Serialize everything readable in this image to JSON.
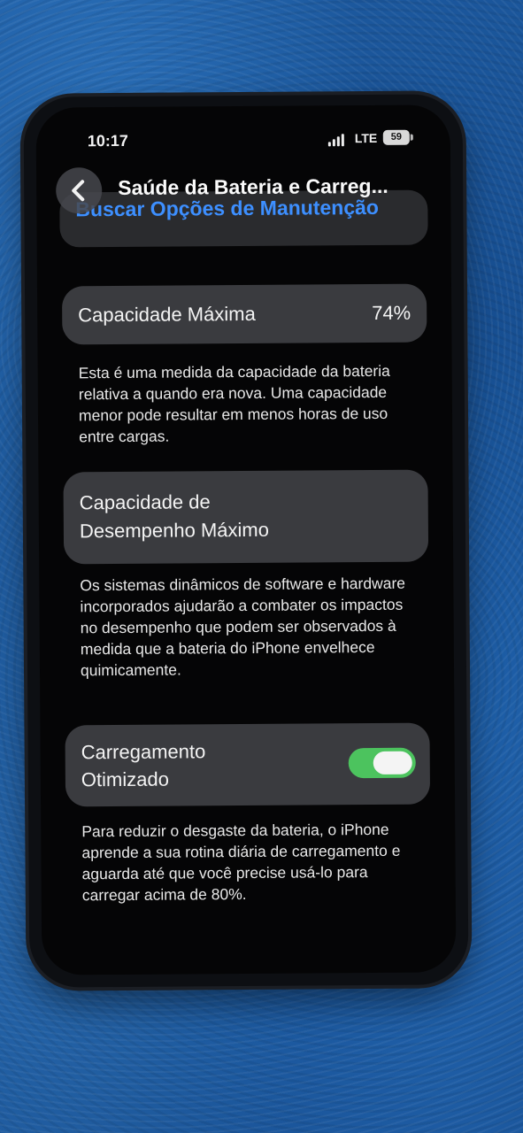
{
  "status_bar": {
    "time": "10:17",
    "network": "LTE",
    "battery_percent": "59"
  },
  "nav": {
    "title": "Saúde da Bateria e Carreg..."
  },
  "top_card": {
    "link_label": "Buscar Opções de Manutenção"
  },
  "max_capacity": {
    "label": "Capacidade Máxima",
    "value": "74%",
    "description": "Esta é uma medida da capacidade da bateria relativa a quando era nova. Uma capacidade menor pode resultar em menos horas de uso entre cargas."
  },
  "peak_performance": {
    "label_line1": "Capacidade de",
    "label_line2": "Desempenho Máximo",
    "description": "Os sistemas dinâmicos de software e hardware incorporados ajudarão a combater os impactos no desempenho que podem ser observados à medida que a bateria do iPhone envelhece quimicamente."
  },
  "optimized_charging": {
    "label_line1": "Carregamento",
    "label_line2": "Otimizado",
    "enabled": true,
    "toggle_color": "#4cc35e",
    "description": "Para reduzir o desgaste da bateria, o iPhone aprende a sua rotina diária de carregamento e aguarda até que você precise usá-lo para carregar acima de 80%."
  }
}
